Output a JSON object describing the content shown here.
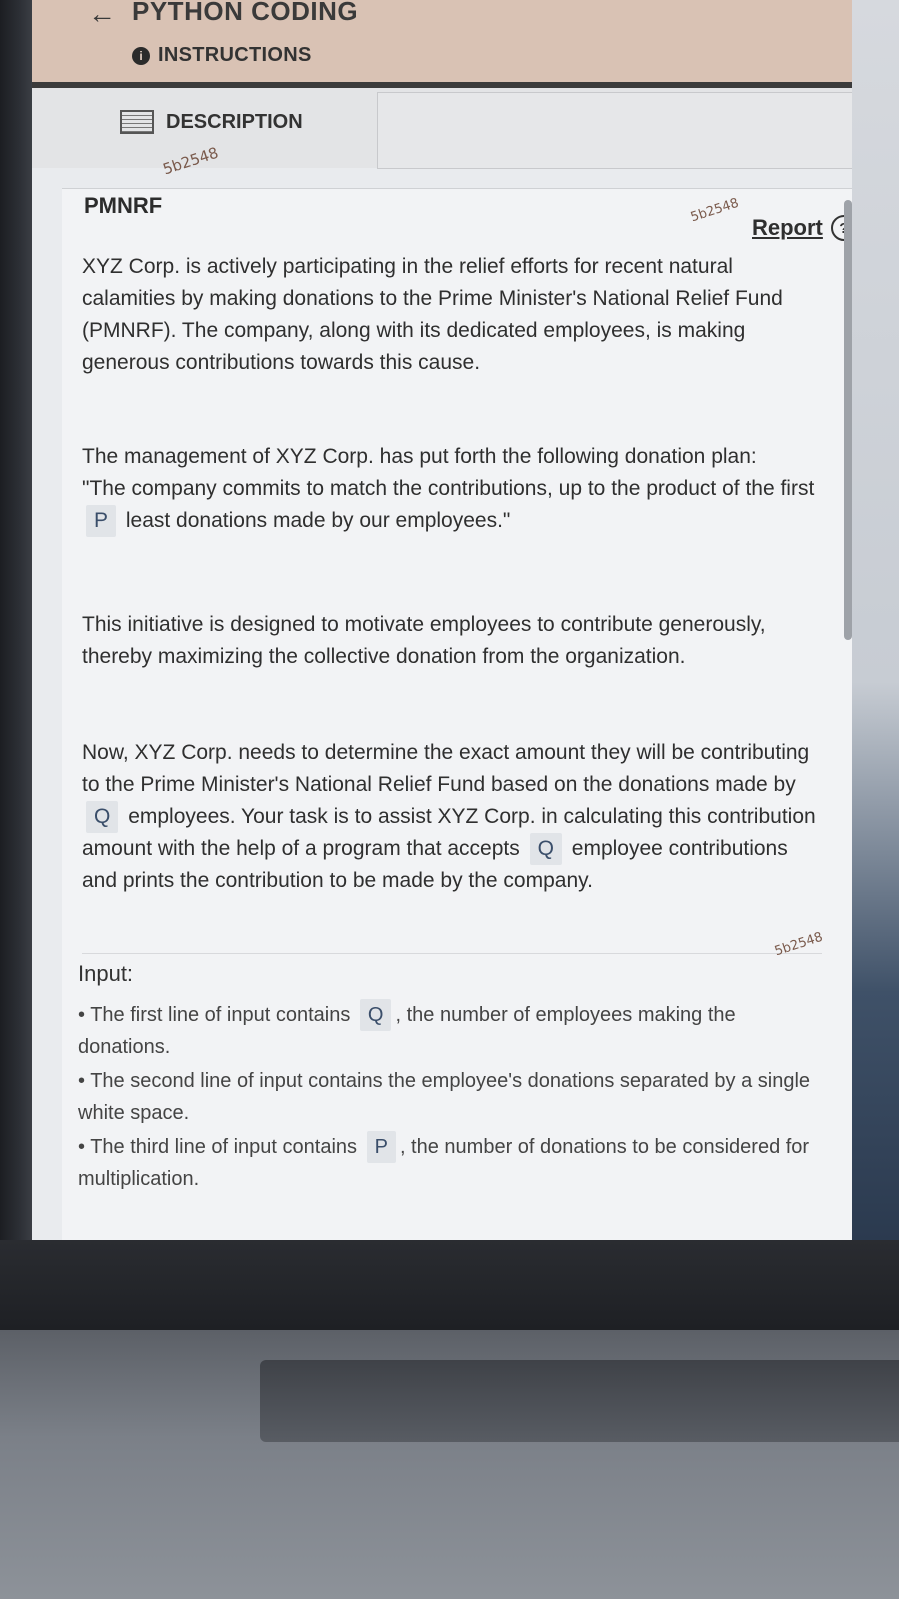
{
  "header": {
    "back_arrow": "←",
    "title": "PYTHON CODING",
    "instructions_label": "INSTRUCTIONS"
  },
  "tabs": {
    "description_label": "DESCRIPTION"
  },
  "watermark": "5b2548",
  "problem": {
    "title": "PMNRF",
    "report_label": "Report",
    "paragraphs": {
      "p1": "XYZ Corp. is actively participating in the relief efforts for recent natural calamities by making donations to the Prime Minister's National Relief Fund (PMNRF). The company, along with its dedicated employees, is making generous contributions towards this cause.",
      "p2_a": "The management of XYZ Corp. has put forth the following donation plan:",
      "p2_b_1": "\"The company commits to match the contributions, up to the product of the first",
      "p2_b_var": "P",
      "p2_b_2": "least donations made by our employees.\"",
      "p3": "This initiative is designed to motivate employees to contribute generously, thereby maximizing the collective donation from the organization.",
      "p4_1": "Now, XYZ Corp. needs to determine the exact amount they will be contributing to the Prime Minister's National Relief Fund based on the donations made by",
      "p4_var1": "Q",
      "p4_2": "employees. Your task is to assist XYZ Corp. in calculating this contribution amount with the help of a program that accepts",
      "p4_var2": "Q",
      "p4_3": "employee contributions and prints the contribution to be made by the company."
    },
    "input": {
      "heading": "Input:",
      "b1_1": "The first line of input contains",
      "b1_var": "Q",
      "b1_2": ", the number of employees making the donations.",
      "b2": "The second line of input contains the employee's donations separated by a single white space.",
      "b3_1": "The third line of input contains",
      "b3_var": "P",
      "b3_2": ", the number of donations to be considered for multiplication."
    }
  }
}
